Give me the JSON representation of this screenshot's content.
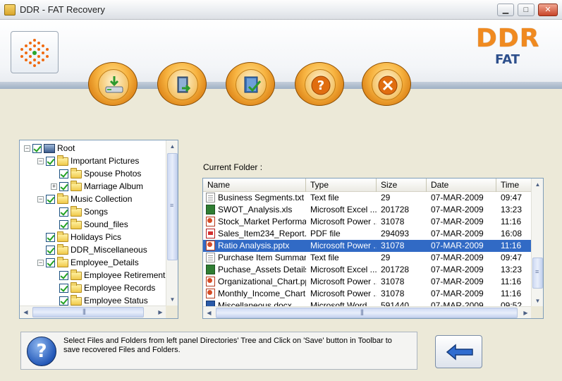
{
  "window": {
    "title": "DDR - FAT Recovery",
    "minimize": "▁",
    "maximize": "□",
    "close": "✕"
  },
  "brand": {
    "main": "DDR",
    "sub": "FAT"
  },
  "toolbar": [
    {
      "name": "save-button",
      "icon": "save-drive-icon"
    },
    {
      "name": "open-button",
      "icon": "door-exit-icon"
    },
    {
      "name": "register-button",
      "icon": "book-check-icon"
    },
    {
      "name": "help-button",
      "icon": "question-icon"
    },
    {
      "name": "exit-button",
      "icon": "close-icon"
    }
  ],
  "tree": {
    "items": [
      {
        "label": "Root",
        "level": 0,
        "expander": "−",
        "icon": "computer"
      },
      {
        "label": "Important Pictures",
        "level": 1,
        "expander": "−",
        "icon": "folder"
      },
      {
        "label": "Spouse Photos",
        "level": 2,
        "expander": "",
        "icon": "folder"
      },
      {
        "label": "Marriage Album",
        "level": 2,
        "expander": "+",
        "icon": "folder"
      },
      {
        "label": "Music Collection",
        "level": 1,
        "expander": "−",
        "icon": "folder"
      },
      {
        "label": "Songs",
        "level": 2,
        "expander": "",
        "icon": "folder"
      },
      {
        "label": "Sound_files",
        "level": 2,
        "expander": "",
        "icon": "folder"
      },
      {
        "label": "Holidays Pics",
        "level": 1,
        "expander": "",
        "icon": "folder"
      },
      {
        "label": "DDR_Miscellaneous",
        "level": 1,
        "expander": "",
        "icon": "folder"
      },
      {
        "label": "Employee_Details",
        "level": 1,
        "expander": "−",
        "icon": "folder"
      },
      {
        "label": "Employee Retirement",
        "level": 2,
        "expander": "",
        "icon": "folder"
      },
      {
        "label": "Employee Records",
        "level": 2,
        "expander": "",
        "icon": "folder"
      },
      {
        "label": "Employee Status",
        "level": 2,
        "expander": "",
        "icon": "folder"
      }
    ]
  },
  "current_folder": {
    "label": "Current Folder  :"
  },
  "list": {
    "columns": [
      "Name",
      "Type",
      "Size",
      "Date",
      "Time"
    ],
    "rows": [
      {
        "name": "Business Segments.txt",
        "type": "Text file",
        "size": "29",
        "date": "07-MAR-2009",
        "time": "09:47",
        "icon": "txt"
      },
      {
        "name": "SWOT_Analysis.xls",
        "type": "Microsoft Excel ...",
        "size": "201728",
        "date": "07-MAR-2009",
        "time": "13:23",
        "icon": "xls"
      },
      {
        "name": "Stock_Market Performa...",
        "type": "Microsoft Power ...",
        "size": "31078",
        "date": "07-MAR-2009",
        "time": "11:16",
        "icon": "ppt"
      },
      {
        "name": "Sales_Item234_Report....",
        "type": "PDF file",
        "size": "294093",
        "date": "07-MAR-2009",
        "time": "16:08",
        "icon": "pdf"
      },
      {
        "name": "Ratio Analysis.pptx",
        "type": "Microsoft Power ...",
        "size": "31078",
        "date": "07-MAR-2009",
        "time": "11:16",
        "icon": "ppt",
        "selected": true
      },
      {
        "name": "Purchase Item Summary...",
        "type": "Text file",
        "size": "29",
        "date": "07-MAR-2009",
        "time": "09:47",
        "icon": "txt"
      },
      {
        "name": "Puchase_Assets Details...",
        "type": "Microsoft Excel ...",
        "size": "201728",
        "date": "07-MAR-2009",
        "time": "13:23",
        "icon": "xls"
      },
      {
        "name": "Organizational_Chart.pptx",
        "type": "Microsoft Power ...",
        "size": "31078",
        "date": "07-MAR-2009",
        "time": "11:16",
        "icon": "ppt"
      },
      {
        "name": "Monthly_Income_Chart....",
        "type": "Microsoft Power ...",
        "size": "31078",
        "date": "07-MAR-2009",
        "time": "11:16",
        "icon": "ppt"
      },
      {
        "name": "Miscellaneous.docx",
        "type": "Microsoft Word ...",
        "size": "591440",
        "date": "07-MAR-2009",
        "time": "09:52",
        "icon": "doc"
      }
    ]
  },
  "info": {
    "text": "Select Files and Folders from left panel Directories' Tree and Click on 'Save' button in Toolbar to save recovered Files and Folders."
  },
  "colors": {
    "brand_orange": "#f08a20",
    "brand_blue": "#2d4f8c",
    "selection": "#316ac5"
  }
}
